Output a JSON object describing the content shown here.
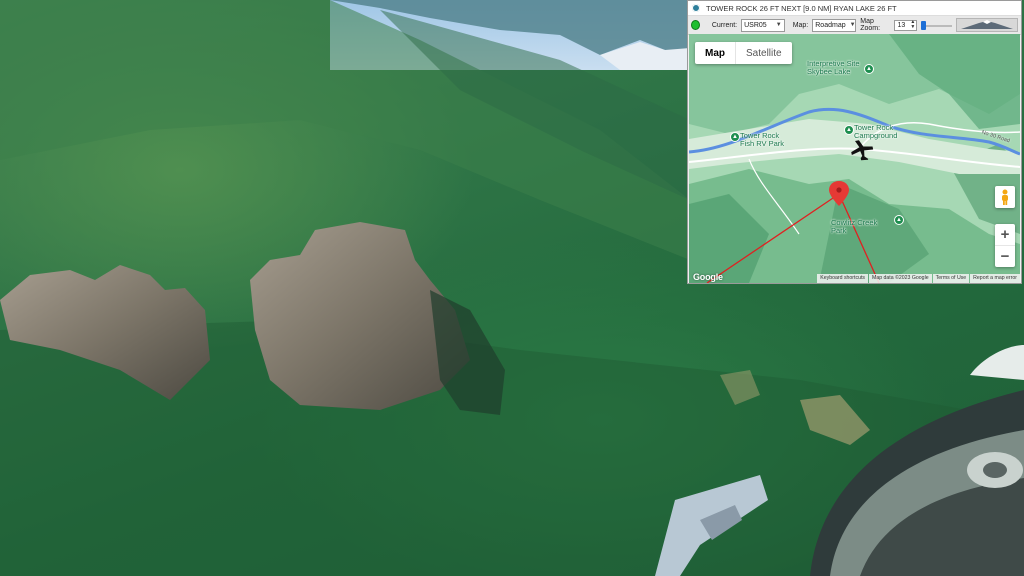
{
  "window": {
    "title": "TOWER ROCK 26 FT NEXT [9.0 NM] RYAN LAKE 26 FT"
  },
  "toolbar": {
    "current_label": "Current:",
    "current_value": "USR05",
    "map_label": "Map:",
    "map_value": "Roadmap",
    "zoom_label": "Map Zoom:",
    "zoom_value": "13"
  },
  "map": {
    "map_type_options": [
      "Map",
      "Satellite"
    ],
    "selected_map_type": "Map",
    "zoom_in_label": "+",
    "zoom_out_label": "−",
    "poi": [
      {
        "label": "Interpretive Site Skybee Lake"
      },
      {
        "label": "Tower Rock Campground"
      },
      {
        "label": "Tower Rock Fish RV Park"
      },
      {
        "label": "Cowlitz Creek Park"
      }
    ],
    "road_label": "No 30 Road",
    "footer": [
      "Keyboard shortcuts",
      "Map data ©2023 Google",
      "Terms of Use",
      "Report a map error"
    ],
    "logo": "Google"
  },
  "colors": {
    "status_led": "#1fbf2f",
    "route_line": "#e02020",
    "marker": "#e53935",
    "terrain": "#9fd2ae",
    "river": "#5b8fe0"
  }
}
